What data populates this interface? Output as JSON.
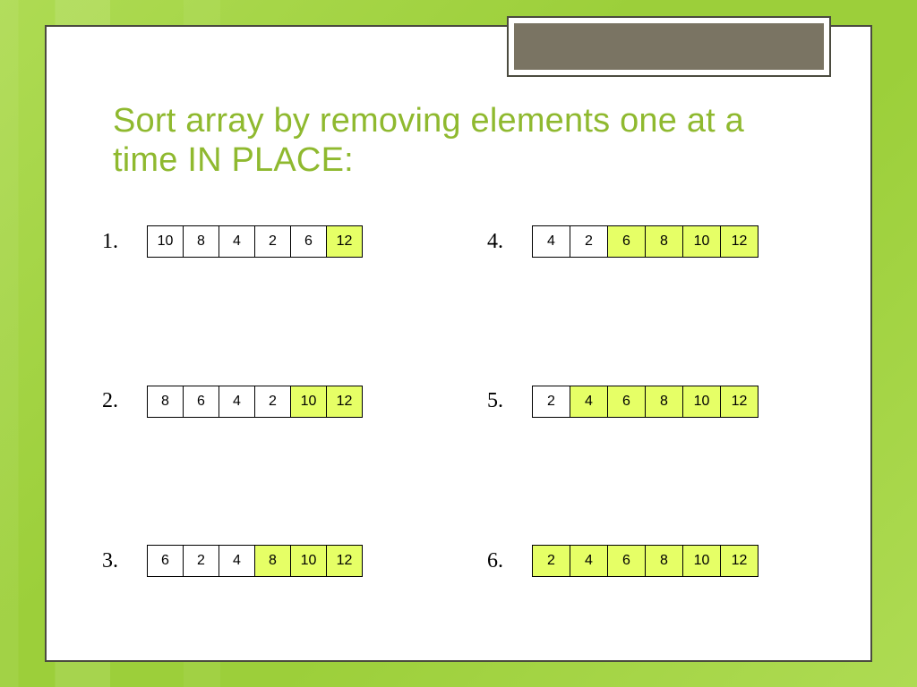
{
  "title": "Sort array by removing elements one at a time IN PLACE:",
  "colors": {
    "accent": "#8fb92f",
    "highlight": "#e6ff66",
    "tab": "#7a7463",
    "border": "#4b4b3f"
  },
  "steps": [
    {
      "label": "1.",
      "cells": [
        {
          "v": "10",
          "hl": false
        },
        {
          "v": "8",
          "hl": false
        },
        {
          "v": "4",
          "hl": false
        },
        {
          "v": "2",
          "hl": false
        },
        {
          "v": "6",
          "hl": false
        },
        {
          "v": "12",
          "hl": true
        }
      ]
    },
    {
      "label": "2.",
      "cells": [
        {
          "v": "8",
          "hl": false
        },
        {
          "v": "6",
          "hl": false
        },
        {
          "v": "4",
          "hl": false
        },
        {
          "v": "2",
          "hl": false
        },
        {
          "v": "10",
          "hl": true
        },
        {
          "v": "12",
          "hl": true
        }
      ]
    },
    {
      "label": "3.",
      "cells": [
        {
          "v": "6",
          "hl": false
        },
        {
          "v": "2",
          "hl": false
        },
        {
          "v": "4",
          "hl": false
        },
        {
          "v": "8",
          "hl": true
        },
        {
          "v": "10",
          "hl": true
        },
        {
          "v": "12",
          "hl": true
        }
      ]
    },
    {
      "label": "4.",
      "cells": [
        {
          "v": "4",
          "hl": false
        },
        {
          "v": "2",
          "hl": false
        },
        {
          "v": "6",
          "hl": true
        },
        {
          "v": "8",
          "hl": true
        },
        {
          "v": "10",
          "hl": true
        },
        {
          "v": "12",
          "hl": true
        }
      ]
    },
    {
      "label": "5.",
      "cells": [
        {
          "v": "2",
          "hl": false
        },
        {
          "v": "4",
          "hl": true
        },
        {
          "v": "6",
          "hl": true
        },
        {
          "v": "8",
          "hl": true
        },
        {
          "v": "10",
          "hl": true
        },
        {
          "v": "12",
          "hl": true
        }
      ]
    },
    {
      "label": "6.",
      "cells": [
        {
          "v": "2",
          "hl": true
        },
        {
          "v": "4",
          "hl": true
        },
        {
          "v": "6",
          "hl": true
        },
        {
          "v": "8",
          "hl": true
        },
        {
          "v": "10",
          "hl": true
        },
        {
          "v": "12",
          "hl": true
        }
      ]
    }
  ]
}
